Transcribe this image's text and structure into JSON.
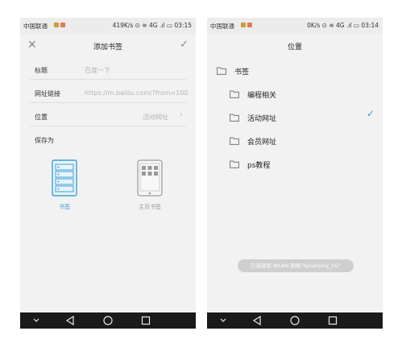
{
  "left_screen": {
    "status": {
      "carrier": "中国联通",
      "right": "419K/s ⊙ ≋ 4G .ıl ▭ 03:15"
    },
    "title": "添加书签",
    "fields": {
      "title_label": "标题",
      "title_placeholder": "百度一下",
      "url_label": "网址链接",
      "url_value": "https://m.baidu.com/?from=1000953",
      "location_label": "位置",
      "location_value": "活动网址"
    },
    "save_as": {
      "label": "保存为",
      "options": [
        {
          "label": "书签",
          "selected": true
        },
        {
          "label": "主页书签",
          "selected": false
        }
      ]
    }
  },
  "right_screen": {
    "status": {
      "carrier": "中国联通",
      "right": "0K/s ⊙ ≋ 4G .ıl ▭ 03:14"
    },
    "title": "位置",
    "folders": [
      {
        "label": "书签"
      },
      {
        "label": "编程相关"
      },
      {
        "label": "活动网址",
        "selected": true
      },
      {
        "label": "会员网址"
      },
      {
        "label": "ps教程"
      }
    ],
    "toast": "已连接到 WLAN 网络\"liyuanjing_5G\""
  },
  "colors": {
    "accent": "#3b9fd8",
    "nav_bg": "#1a1a1a",
    "screen_bg": "#f2f2f2"
  },
  "icons": [
    "close-icon",
    "check-icon",
    "chevron-right-icon",
    "folder-icon",
    "back-icon",
    "home-icon",
    "recents-icon",
    "collapse-icon"
  ]
}
